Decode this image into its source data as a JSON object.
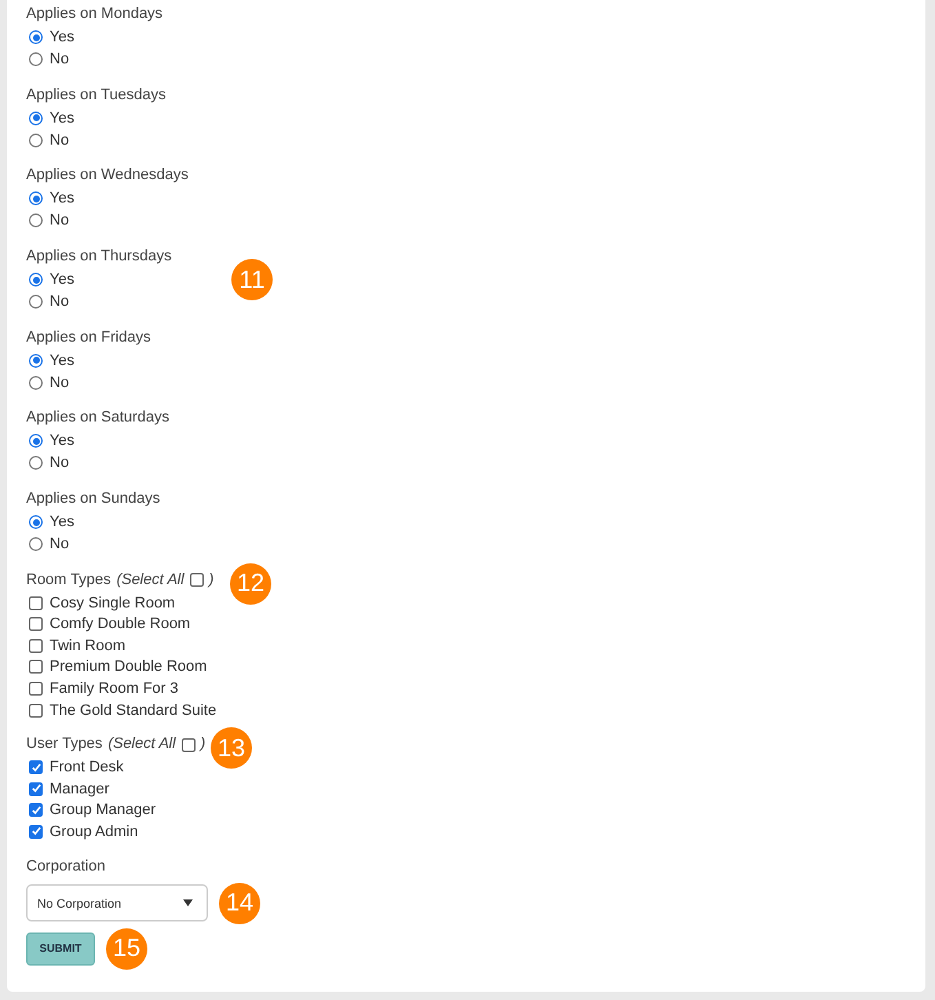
{
  "days": [
    {
      "label": "Applies on Mondays",
      "options": [
        {
          "label": "Yes",
          "selected": true
        },
        {
          "label": "No",
          "selected": false
        }
      ]
    },
    {
      "label": "Applies on Tuesdays",
      "options": [
        {
          "label": "Yes",
          "selected": true
        },
        {
          "label": "No",
          "selected": false
        }
      ]
    },
    {
      "label": "Applies on Wednesdays",
      "options": [
        {
          "label": "Yes",
          "selected": true
        },
        {
          "label": "No",
          "selected": false
        }
      ]
    },
    {
      "label": "Applies on Thursdays",
      "options": [
        {
          "label": "Yes",
          "selected": true
        },
        {
          "label": "No",
          "selected": false
        }
      ],
      "annotation": "11"
    },
    {
      "label": "Applies on Fridays",
      "options": [
        {
          "label": "Yes",
          "selected": true
        },
        {
          "label": "No",
          "selected": false
        }
      ]
    },
    {
      "label": "Applies on Saturdays",
      "options": [
        {
          "label": "Yes",
          "selected": true
        },
        {
          "label": "No",
          "selected": false
        }
      ]
    },
    {
      "label": "Applies on Sundays",
      "options": [
        {
          "label": "Yes",
          "selected": true
        },
        {
          "label": "No",
          "selected": false
        }
      ]
    }
  ],
  "checklists": [
    {
      "label": "Room Types",
      "select_all": {
        "label": "(Select All",
        "close": ")",
        "checked": false
      },
      "annotation": "12",
      "items": [
        {
          "label": "Cosy Single Room",
          "checked": false
        },
        {
          "label": "Comfy Double Room",
          "checked": false
        },
        {
          "label": "Twin Room",
          "checked": false
        },
        {
          "label": "Premium Double Room",
          "checked": false
        },
        {
          "label": "Family Room For 3",
          "checked": false
        },
        {
          "label": "The Gold Standard Suite",
          "checked": false
        }
      ]
    },
    {
      "label": "User Types",
      "select_all": {
        "label": "(Select All",
        "close": ")",
        "checked": false
      },
      "annotation": "13",
      "items": [
        {
          "label": "Front Desk",
          "checked": true
        },
        {
          "label": "Manager",
          "checked": true
        },
        {
          "label": "Group Manager",
          "checked": true
        },
        {
          "label": "Group Admin",
          "checked": true
        }
      ]
    }
  ],
  "corporation": {
    "label": "Corporation",
    "value": "No Corporation",
    "annotation": "14"
  },
  "submit": {
    "label": "SUBMIT",
    "annotation": "15"
  }
}
